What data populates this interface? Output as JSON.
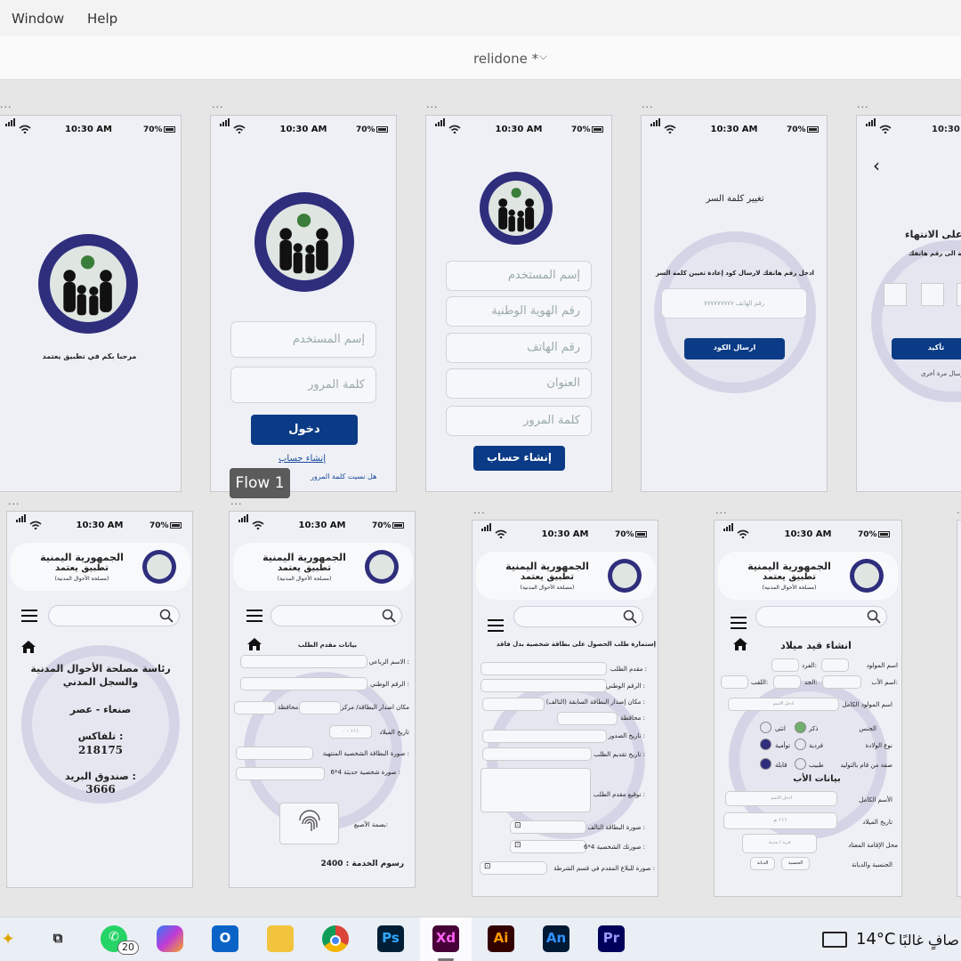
{
  "menu": {
    "window": "Window",
    "help": "Help"
  },
  "document": {
    "title": "relidone *"
  },
  "flow_label": "Flow 1",
  "status": {
    "time": "10:30 AM",
    "battery": "70%"
  },
  "screens": {
    "splash": {
      "welcome": "مرحبا بكم في تطبيق يعتمد"
    },
    "login": {
      "username_placeholder": "إسم المستخدم",
      "password_placeholder": "كلمة المرور",
      "login_button": "دخول",
      "create_account_link": "إنشاء حساب",
      "forgot_password": "هل  نسيت كلمة المرور"
    },
    "register": {
      "username_placeholder": "إسم المستخدم",
      "national_id_placeholder": "رقم الهوية الوطنية",
      "phone_placeholder": "رقم الهاتف",
      "address_placeholder": "العنوان",
      "password_placeholder": "كلمة المرور",
      "create_button": "إنشاء حساب"
    },
    "change_password": {
      "title": "تغيير كلمة السر",
      "instruction": "ادخل رقم هاتفك لارسال كود إعادة تعيين كلمة السر",
      "phone_placeholder": "رقم الهاتف ٧٧٧٧٧٧٧٧٧",
      "send_button": "ارسال الكود"
    },
    "verify": {
      "title": "على الانتهاء",
      "message": "رسالة الى رقم هاتفك",
      "confirm_button": "تأكيد",
      "resend": "لإرسال مرة أخرى"
    },
    "header": {
      "republic": "الجمهورية اليمنية",
      "app": "تطبيق يعتمد",
      "authority": "(مصلحة الأحوال المدنية)"
    },
    "contact": {
      "line1": "رئاسة مصلحة الأحوال المدنية",
      "line2": "والسجل المدني",
      "city": "صنعاء - عصر",
      "phone_label": ": تلفاكس",
      "phone": "218175",
      "pobox_label": ": صندوق البريد",
      "pobox": "3666"
    },
    "applicant": {
      "section_title": "بيانات مقدم الطلب",
      "full_name": "الاسم الرباعي :",
      "national_no": "الرقم الوطني :",
      "issue_place": "مكان اصدار البطاقة/ مركز",
      "governorate": "محافظة",
      "birth_date": "تاريخ الميلاد",
      "birth_placeholder": "١١١ - ٠",
      "expired_card": "صورة البطاقة الشخصية المنتهية :",
      "photo": "صورة شخصية حديثة 4*6 :",
      "fingerprint": "بصمة الأصبع:",
      "fee": "رسوم الخدمة : 2400"
    },
    "lost_card": {
      "title": "إستمارة طلب الحصول على بطاقة شخصية بدل فاقد",
      "applicant": "مقدم الطلب :",
      "national_no": "الرقم الوطني :",
      "issue_place": "مكان إصدار البطاقة السابقة (التالف) :",
      "governorate": "محافظة :",
      "issue_date": "تاريخ الصدور :",
      "request_date": "تاريخ تقديم الطلب :",
      "signature": "توقيع مقدم الطلب :",
      "damaged_card": "صورة البطاقة التالف :",
      "photo": "صورتك الشخصية 4*6 :",
      "police_report": "صورة للبلاغ المقدم في قسم الشرطة :"
    },
    "birth": {
      "title": "انشاء قيد ميلاد",
      "newborn_name": "اسم المولود",
      "individual": "الفرد:",
      "father_name": "اسم الأب:",
      "grandfather": "الجد:",
      "surname": "اللقب:",
      "full_name": "اسم المولود الكامل",
      "full_placeholder": "ادخل الاسم",
      "gender": "الجنس",
      "male": "ذكر",
      "female": "انثى",
      "birth_type": "نوع الولادة",
      "single": "فردية",
      "twins": "توأمية",
      "delivered_by": "صفة من قام بالتوليد",
      "doctor": "طبيب",
      "midwife": "قابلة",
      "father_section": "بيانات الأب",
      "father_full": "الأسم الكامل",
      "father_placeholder": "ادخل الاسم",
      "birth_date": "تاريخ الميلاد",
      "date_placeholder": "١١١  م",
      "residence": "محل الإقامة المعتاد",
      "residence_placeholder": "قرية / مدينة",
      "nationality": "الجنسية والديانة",
      "nationality_value": "الجنسية",
      "religion_value": "الديانة"
    }
  },
  "taskbar": {
    "whatsapp_badge": "20",
    "temperature": "14°C",
    "weather": "صافٍ غالبًا",
    "apps": {
      "ps": "Ps",
      "xd": "Xd",
      "ai": "Ai",
      "an": "An",
      "pr": "Pr"
    }
  },
  "colors": {
    "primary": "#0b3b86",
    "emblem": "#2f2e7d",
    "xd": "#470137"
  }
}
